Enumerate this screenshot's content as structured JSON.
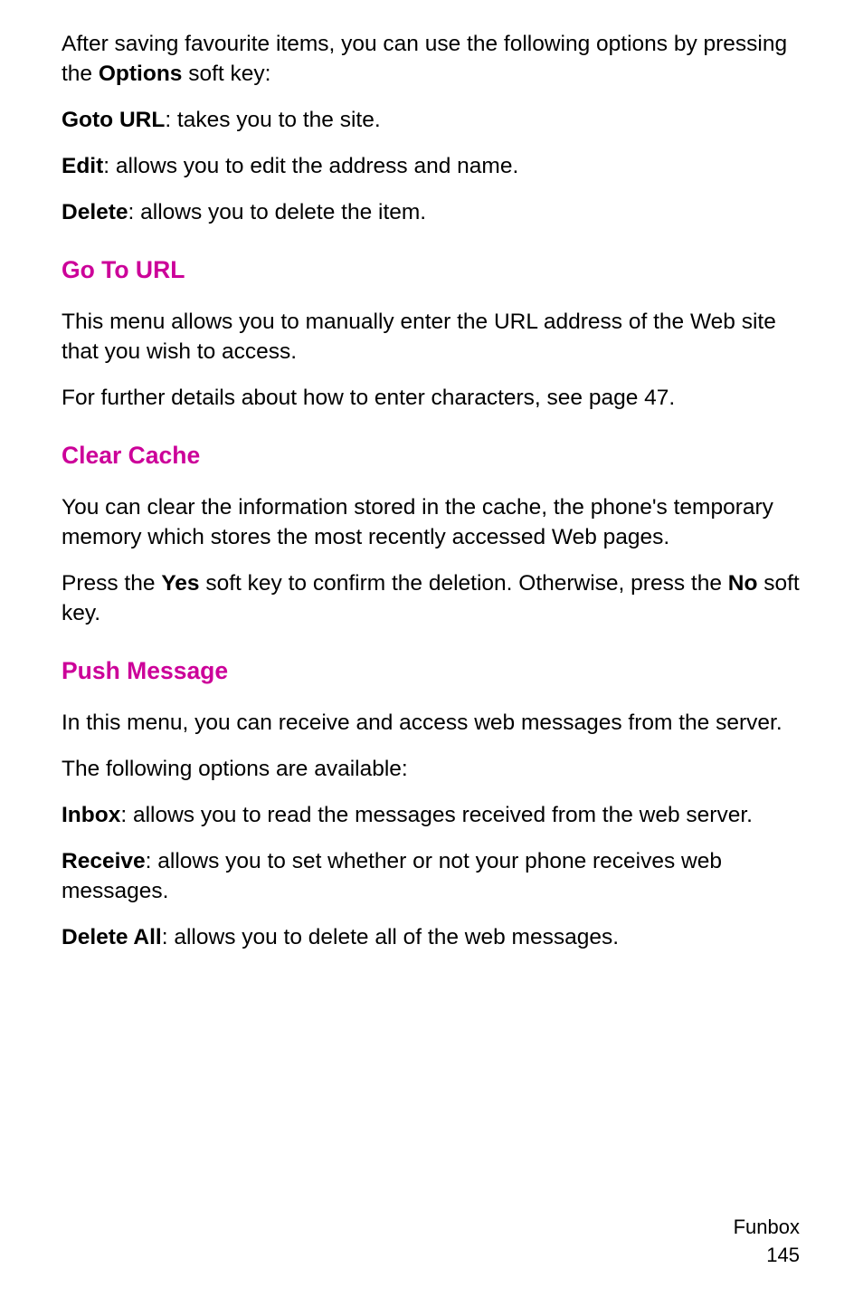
{
  "intro": {
    "p1a": "After saving favourite items, you can use the following options by pressing the ",
    "p1b": "Options",
    "p1c": " soft key:"
  },
  "options": {
    "gotoUrlLabel": "Goto URL",
    "gotoUrlDesc": ": takes you to the site.",
    "editLabel": "Edit",
    "editDesc": ": allows you to edit the address and name.",
    "deleteLabel": "Delete",
    "deleteDesc": ": allows you to delete the item."
  },
  "sections": {
    "goToUrl": {
      "heading": "Go To URL",
      "p1": "This menu allows you to manually enter the URL address of the Web site that you wish to access.",
      "p2": "For further details about how to enter characters, see page 47."
    },
    "clearCache": {
      "heading": "Clear Cache",
      "p1": "You can clear the information stored in the cache, the phone's temporary memory which stores the most recently accessed Web pages.",
      "p2a": "Press the ",
      "p2b": "Yes",
      "p2c": " soft key to confirm the deletion. Otherwise, press the ",
      "p2d": "No",
      "p2e": " soft key."
    },
    "pushMessage": {
      "heading": "Push Message",
      "p1": "In this menu, you can receive and access web messages from the server.",
      "p2": "The following options are available:",
      "inboxLabel": "Inbox",
      "inboxDesc": ": allows you to read the messages received from the web server.",
      "receiveLabel": "Receive",
      "receiveDesc": ": allows you to set whether or not your phone receives web messages.",
      "deleteAllLabel": "Delete All",
      "deleteAllDesc": ": allows you to delete all of the web messages."
    }
  },
  "footer": {
    "section": "Funbox",
    "page": "145"
  }
}
